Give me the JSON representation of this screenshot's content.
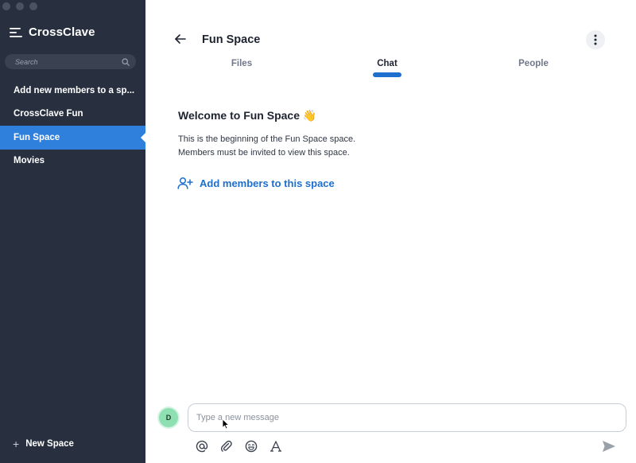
{
  "app": {
    "name": "CrossClave"
  },
  "sidebar": {
    "search_placeholder": "Search",
    "spaces": [
      {
        "label": "Add new members to a sp...",
        "active": false
      },
      {
        "label": "CrossClave Fun",
        "active": false
      },
      {
        "label": "Fun Space",
        "active": true
      },
      {
        "label": "Movies",
        "active": false
      }
    ],
    "new_space_label": "New Space",
    "new_space_icon": "+"
  },
  "header": {
    "title": "Fun Space",
    "tabs": [
      {
        "label": "Files",
        "active": false
      },
      {
        "label": "Chat",
        "active": true
      },
      {
        "label": "People",
        "active": false
      }
    ]
  },
  "chat": {
    "welcome": "Welcome to Fun Space",
    "welcome_emoji": "👋",
    "intro_line1": "This is the beginning of the Fun Space space.",
    "intro_line2": "Members must be invited to view this space.",
    "add_members_label": "Add members to this space"
  },
  "composer": {
    "avatar_initial": "D",
    "placeholder": "Type a new message",
    "value": ""
  },
  "colors": {
    "sidebar_bg": "#283040",
    "active_item": "#2f80dd",
    "accent": "#1d6fce",
    "avatar": "#8ee0b2"
  },
  "icons": [
    "menu-icon",
    "search-icon",
    "plus-icon",
    "back-arrow-icon",
    "more-vertical-icon",
    "user-plus-icon",
    "at-icon",
    "paperclip-icon",
    "emoji-icon",
    "font-format-icon",
    "send-icon"
  ]
}
